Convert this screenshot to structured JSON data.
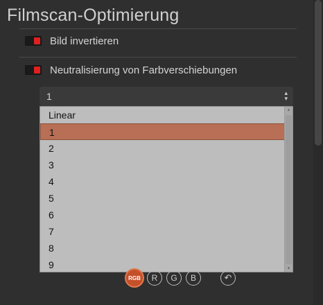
{
  "section": {
    "title": "Filmscan-Optimierung"
  },
  "toggles": [
    {
      "label": "Bild invertieren",
      "state": "on"
    },
    {
      "label": "Neutralisierung von Farbverschiebungen",
      "state": "on"
    }
  ],
  "select": {
    "value": "1",
    "arrows": "▴▾"
  },
  "dropdown": {
    "items": [
      "Linear",
      "1",
      "2",
      "3",
      "4",
      "5",
      "6",
      "7",
      "8",
      "9"
    ],
    "selected_index": 1
  },
  "channels": {
    "rgb": "RGB",
    "r": "R",
    "g": "G",
    "b": "B",
    "reset_icon": "↶"
  },
  "colors": {
    "accent": "#b86f55",
    "toggle_on": "#e02020",
    "rgb_active": "#c4502a"
  }
}
